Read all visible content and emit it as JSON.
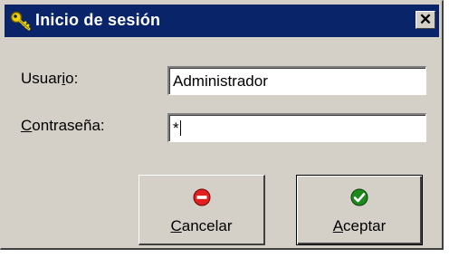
{
  "window": {
    "title": "Inicio de sesión",
    "title_icon": "key-icon",
    "close_label": "✕"
  },
  "form": {
    "user_label_pre": "Usuar",
    "user_label_mnemonic": "i",
    "user_label_post": "o:",
    "user_value": "Administrador",
    "password_label_mnemonic": "C",
    "password_label_post": "ontraseña:",
    "password_value": "*"
  },
  "buttons": {
    "cancel_mnemonic": "C",
    "cancel_rest": "ancelar",
    "cancel_icon": "stop-icon",
    "cancel_icon_color": "#e02020",
    "accept_mnemonic": "A",
    "accept_rest": "ceptar",
    "accept_icon": "check-icon",
    "accept_icon_color": "#1e8a1e"
  },
  "colors": {
    "titlebar": "#0a246a",
    "dialog_face": "#d4d0c8"
  }
}
